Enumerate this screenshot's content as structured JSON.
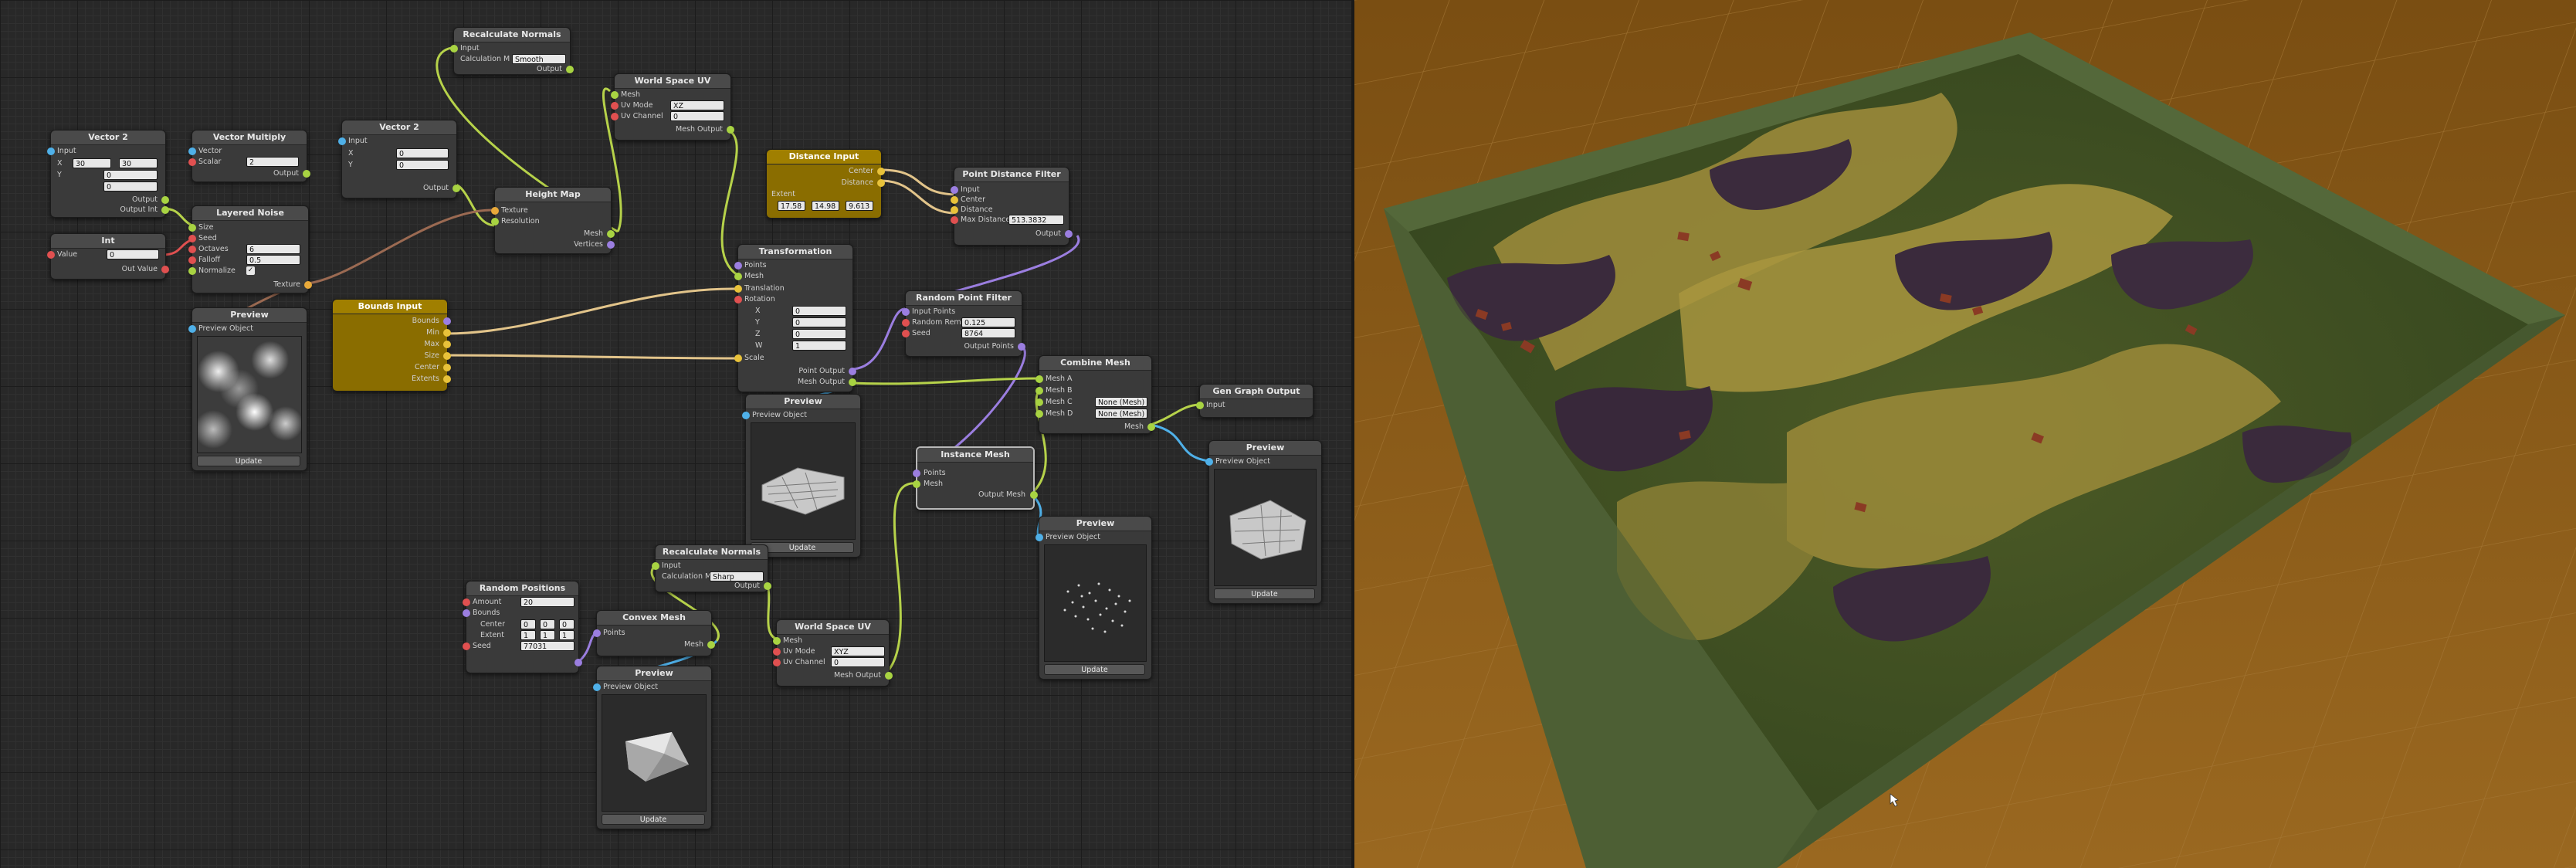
{
  "nodes": {
    "recalc_top": {
      "title": "Recalculate Normals",
      "input": "Input",
      "calc_label": "Calculation M",
      "calc_value": "Smooth",
      "output": "Output"
    },
    "wsuv_top": {
      "title": "World Space UV",
      "mesh": "Mesh",
      "uv_mode": "Uv Mode",
      "uv_mode_value": "XZ",
      "uv_channel": "Uv Channel",
      "uv_channel_value": "0",
      "mesh_output": "Mesh Output"
    },
    "vec2_a": {
      "title": "Vector 2",
      "input": "Input",
      "x": "X",
      "y": "Y",
      "xv": "30",
      "yv": "30",
      "v3": "0",
      "v4": "0",
      "output": "Output",
      "output2": "Output Int"
    },
    "vec_mult": {
      "title": "Vector Multiply",
      "vector": "Vector",
      "scalar": "Scalar",
      "scalar_value": "2",
      "output": "Output"
    },
    "vec2_b": {
      "title": "Vector 2",
      "input": "Input",
      "x": "X",
      "y": "Y",
      "xv": "0",
      "yv": "0",
      "output": "Output"
    },
    "layered": {
      "title": "Layered Noise",
      "size": "Size",
      "seed": "Seed",
      "octaves": "Octaves",
      "octaves_value": "6",
      "falloff": "Falloff",
      "falloff_value": "0.5",
      "normalize": "Normalize",
      "texture": "Texture"
    },
    "int": {
      "title": "Int",
      "value": "Value",
      "value_value": "0",
      "out_value": "Out Value"
    },
    "heightmap": {
      "title": "Height Map",
      "texture": "Texture",
      "resolution": "Resolution",
      "mesh": "Mesh",
      "vertices": "Vertices"
    },
    "distance": {
      "title": "Distance Input",
      "center": "Center",
      "distance": "Distance",
      "extent": "Extent",
      "e1": "17.58",
      "e2": "14.98",
      "e3": "9.613"
    },
    "pdf": {
      "title": "Point Distance Filter",
      "input": "Input",
      "center": "Center",
      "distance": "Distance",
      "max_label": "Max Distance",
      "max_value": "513.3832",
      "output": "Output"
    },
    "transform": {
      "title": "Transformation",
      "points": "Points",
      "mesh": "Mesh",
      "translation": "Translation",
      "rotation": "Rotation",
      "x": "X",
      "y": "Y",
      "z": "Z",
      "w": "W",
      "xv": "0",
      "yv": "0",
      "zv": "0",
      "wv": "1",
      "scale": "Scale",
      "point_output": "Point Output",
      "mesh_output": "Mesh Output"
    },
    "bounds": {
      "title": "Bounds Input",
      "bounds": "Bounds",
      "min": "Min",
      "max": "Max",
      "size": "Size",
      "center": "Center",
      "extents": "Extents"
    },
    "rpf": {
      "title": "Random Point Filter",
      "input": "Input Points",
      "rem_label": "Random Rem",
      "rem_value": "0.125",
      "seed": "Seed",
      "seed_value": "8764",
      "output": "Output Points"
    },
    "combine": {
      "title": "Combine Mesh",
      "a": "Mesh A",
      "b": "Mesh B",
      "c": "Mesh C",
      "d": "Mesh D",
      "none1": "None (Mesh)",
      "none2": "None (Mesh)",
      "mesh": "Mesh"
    },
    "gen_out": {
      "title": "Gen Graph Output",
      "input": "Input"
    },
    "preview_noise": {
      "title": "Preview",
      "object": "Preview Object",
      "update": "Update"
    },
    "preview_transform": {
      "title": "Preview",
      "object": "Preview Object",
      "update": "Update"
    },
    "preview_instance": {
      "title": "Preview",
      "object": "Preview Object",
      "update": "Update"
    },
    "preview_final": {
      "title": "Preview",
      "object": "Preview Object",
      "update": "Update"
    },
    "preview_convex": {
      "title": "Preview",
      "object": "Preview Object",
      "update": "Update"
    },
    "instance": {
      "title": "Instance Mesh",
      "points": "Points",
      "mesh": "Mesh",
      "output": "Output Mesh"
    },
    "recalc_bottom": {
      "title": "Recalculate Normals",
      "input": "Input",
      "calc_label": "Calculation M",
      "calc_value": "Sharp",
      "output": "Output"
    },
    "random_pos": {
      "title": "Random Positions",
      "amount": "Amount",
      "bounds": "Bounds",
      "center": "Center",
      "extent": "Extent",
      "seed": "Seed",
      "amount_value": "20",
      "c1": "0",
      "c2": "0",
      "c3": "0",
      "e1": "1",
      "e2": "1",
      "e3": "1",
      "seed_value": "77031"
    },
    "convex": {
      "title": "Convex Mesh",
      "points": "Points",
      "mesh": "Mesh"
    },
    "wsuv_bottom": {
      "title": "World Space UV",
      "mesh": "Mesh",
      "uv_mode": "Uv Mode",
      "uv_mode_value": "XYZ",
      "uv_channel": "Uv Channel",
      "uv_channel_value": "0",
      "mesh_output": "Mesh Output"
    }
  },
  "colors": {
    "graph_bg": "#282828",
    "node_bg": "#3a3a3a",
    "gold": "#a07f00",
    "wire_green": "#b6d24a",
    "wire_tan": "#e2c48a",
    "wire_purple": "#9b7ee0",
    "wire_brown": "#9b6a52",
    "scene_bg": "#8a5a1a"
  },
  "icons": [
    "port-dot-icon",
    "check-icon",
    "pointer-cursor-icon"
  ]
}
